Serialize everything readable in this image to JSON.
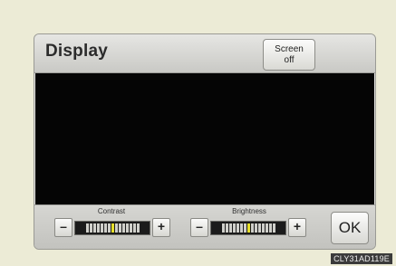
{
  "header": {
    "title": "Display",
    "screen_off": {
      "line1": "Screen",
      "line2": "off"
    }
  },
  "controls": {
    "contrast": {
      "label": "Contrast",
      "minus": "–",
      "plus": "+",
      "level": 0.5,
      "ticks": 15,
      "active_index": 7
    },
    "brightness": {
      "label": "Brightness",
      "minus": "–",
      "plus": "+",
      "level": 0.5,
      "ticks": 15,
      "active_index": 7
    },
    "ok_label": "OK"
  },
  "caption": "CLY31AD119E",
  "colors": {
    "accent_tick": "#e6df2a",
    "display_bg": "#050505",
    "page_bg": "#ecebd6"
  }
}
